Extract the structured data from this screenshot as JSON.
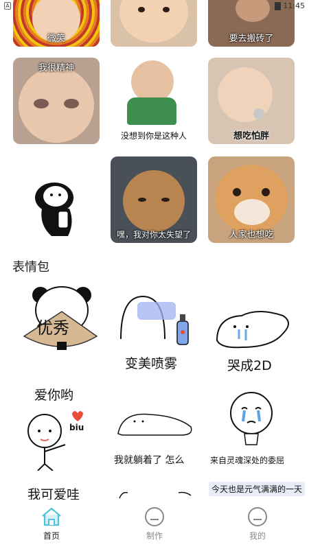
{
  "status_bar": {
    "time": "11:45",
    "left_icon": "A"
  },
  "grid_captions": {
    "r0c0": "微笑",
    "r0c2": "要去搬砖了",
    "r1c0": "我很精神",
    "r1c1": "没想到你是这种人",
    "r1c2": "想吃怕胖",
    "r2c1": "嘿，我对你太失望了",
    "r2c2": "人家也想吃"
  },
  "section": {
    "title": "表情包"
  },
  "stickers": {
    "s1_text": "优秀",
    "s1_label": "爱你哟",
    "s2_label": "变美喷雾",
    "s3_label": "哭成2D",
    "s4_text": "biu",
    "s4_label": "我可爱哇",
    "s5_label": "我就躺着了 怎么",
    "s6_label": "来自灵魂深处的委屈",
    "s7_label": "今天也是元气满满的一天"
  },
  "tabs": [
    {
      "label": "首页",
      "icon": "home-icon",
      "active": true
    },
    {
      "label": "制作",
      "icon": "face-circle-icon",
      "active": false
    },
    {
      "label": "我的",
      "icon": "face-circle-icon",
      "active": false
    }
  ],
  "colors": {
    "accent": "#4dc3dc",
    "tab_inactive": "#888888"
  }
}
